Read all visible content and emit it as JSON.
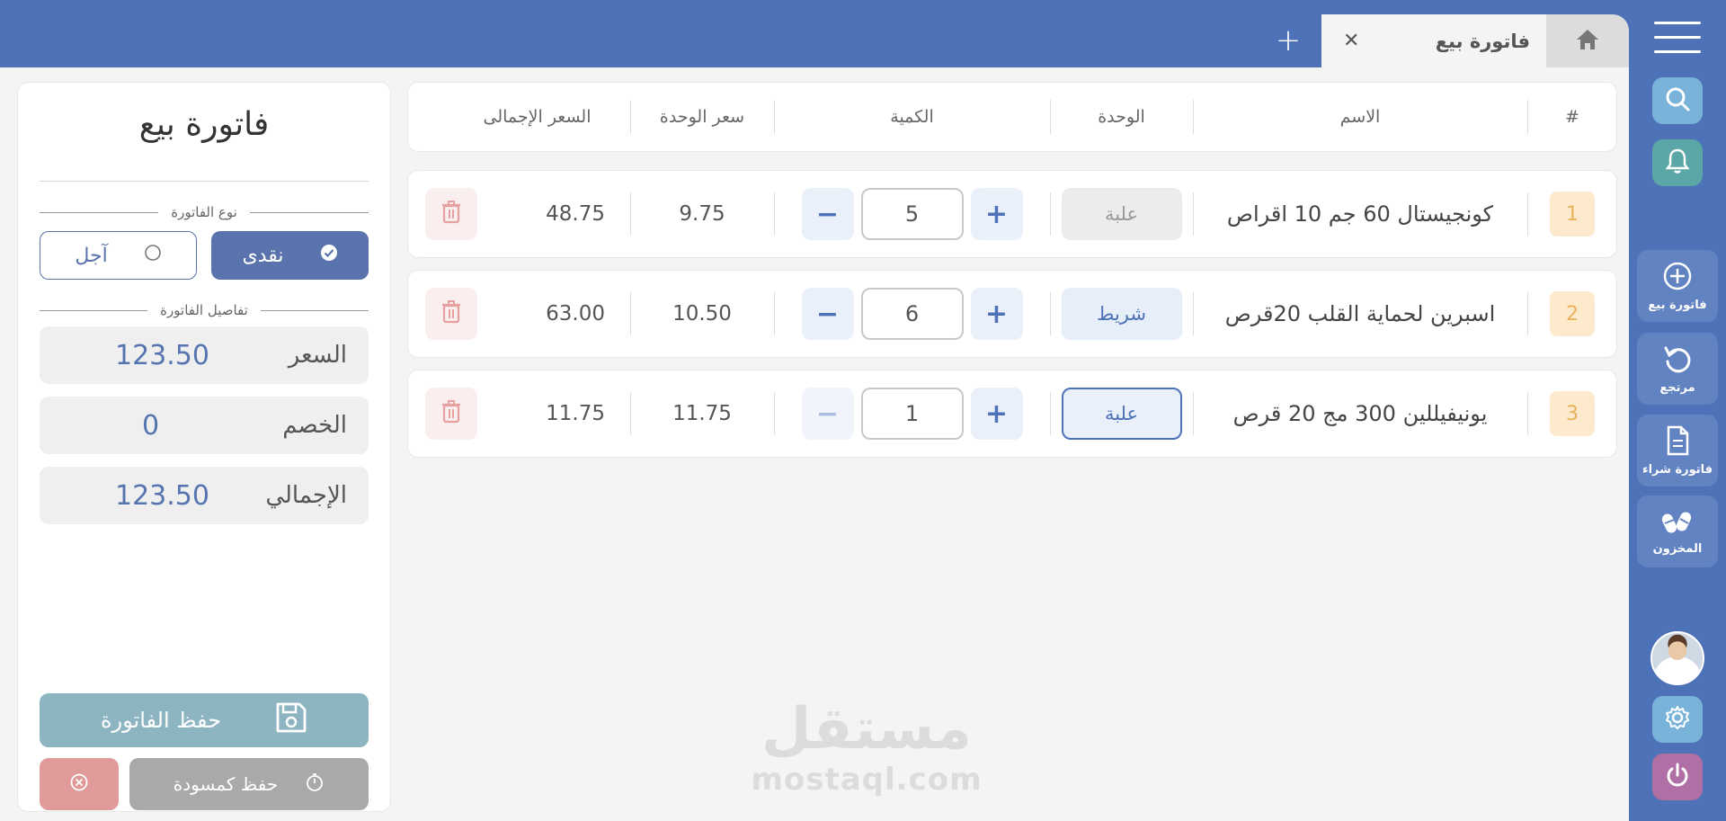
{
  "tabs": {
    "active_label": "فاتورة بيع",
    "close_glyph": "✕",
    "add_glyph": "+"
  },
  "sidebar": {
    "items": [
      {
        "label": "فاتورة بيع",
        "icon": "plus-circle-icon"
      },
      {
        "label": "مرتجع",
        "icon": "undo-icon"
      },
      {
        "label": "فاتورة شراء",
        "icon": "document-icon"
      },
      {
        "label": "المخزون",
        "icon": "pills-icon"
      }
    ],
    "colors": {
      "search": "#7ab3d9",
      "bell": "#5ba6a6",
      "settings": "#7ab3d9",
      "power": "#b06fa5"
    }
  },
  "table": {
    "headers": {
      "index": "#",
      "name": "الاسم",
      "unit": "الوحدة",
      "quantity": "الكمية",
      "unit_price": "سعر الوحدة",
      "total_price": "السعر الإجمالى"
    },
    "rows": [
      {
        "index": "1",
        "name": "كونجيستال 60 جم 10 اقراص",
        "unit": "علبة",
        "unit_state": "disabled",
        "quantity": "5",
        "unit_price": "9.75",
        "total": "48.75"
      },
      {
        "index": "2",
        "name": "اسبرين لحماية القلب 20قرص",
        "unit": "شريط",
        "unit_state": "filled",
        "quantity": "6",
        "unit_price": "10.50",
        "total": "63.00"
      },
      {
        "index": "3",
        "name": "يونيفيللين 300 مج 20 قرص",
        "unit": "علبة",
        "unit_state": "outlined",
        "quantity": "1",
        "unit_price": "11.75",
        "total": "11.75"
      }
    ]
  },
  "panel": {
    "title": "فاتورة بيع",
    "invoice_type_label": "نوع الفاتورة",
    "type_cash": "نقدى",
    "type_credit": "آجل",
    "selected_type": "cash",
    "details_label": "تفاصيل الفاتورة",
    "price_label": "السعر",
    "price_value": "123.50",
    "discount_label": "الخصم",
    "discount_value": "0",
    "total_label": "الإجمالي",
    "total_value": "123.50",
    "save_label": "حفظ الفاتورة",
    "draft_label": "حفظ كمسودة"
  },
  "watermark": {
    "arabic": "مستقل",
    "latin": "mostaql.com"
  },
  "colors": {
    "primary": "#4d72b8",
    "save": "#8db4c1",
    "draft": "#a9a9a9",
    "cancel": "#e09a9a",
    "delete": "#e6a0a0"
  }
}
